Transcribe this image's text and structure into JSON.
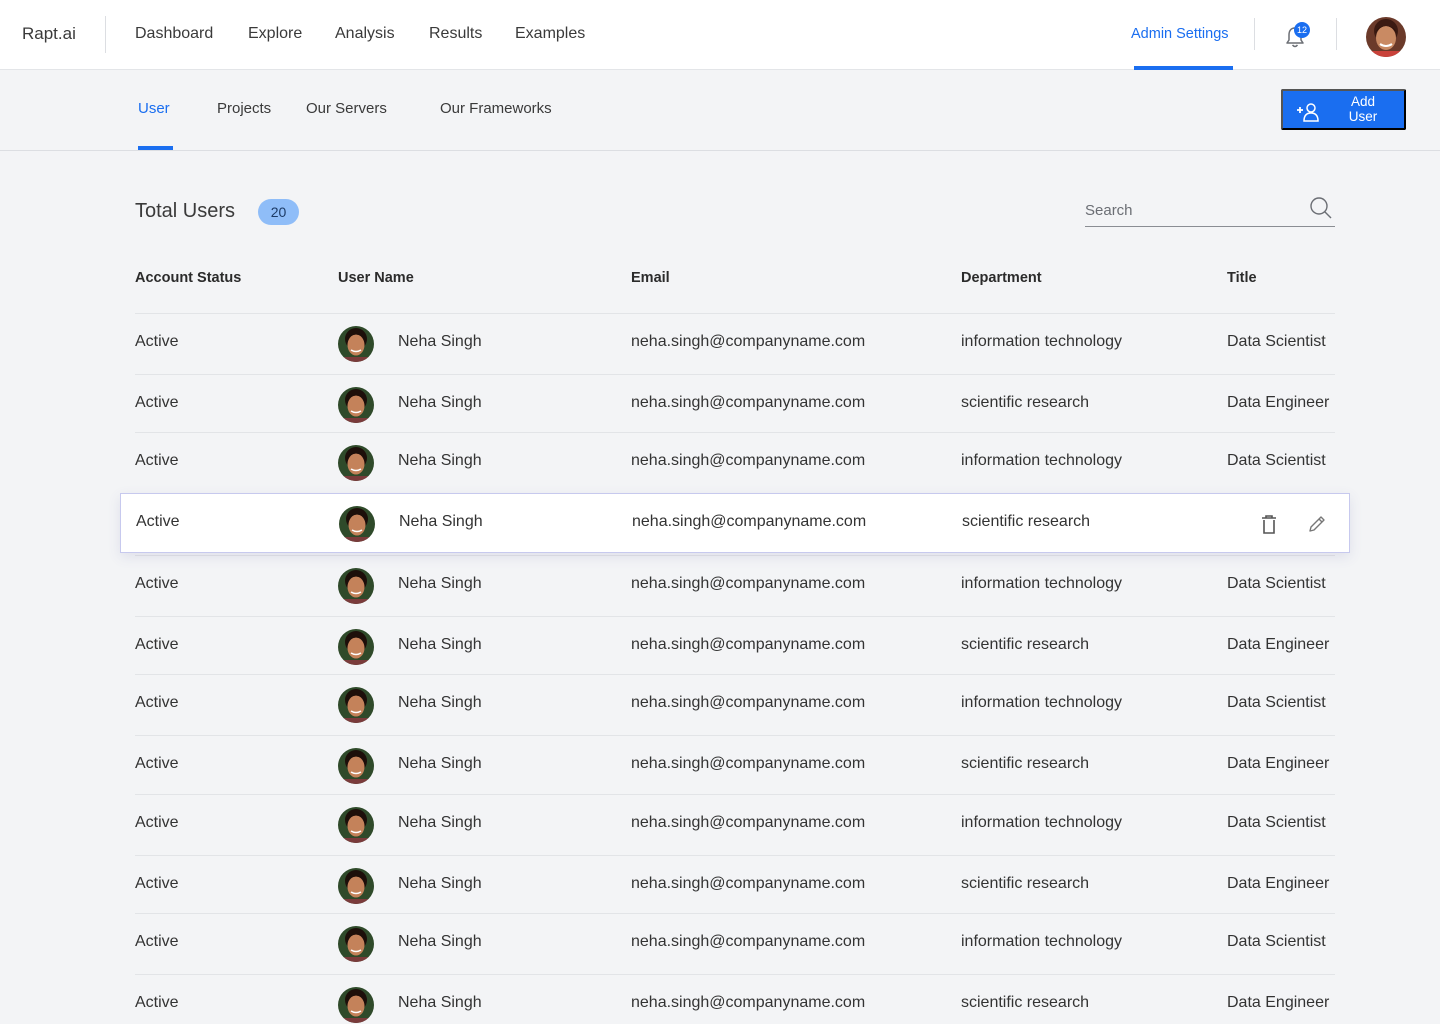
{
  "app": {
    "logo": "Rapt.ai"
  },
  "nav": [
    {
      "label": "Dashboard"
    },
    {
      "label": "Explore"
    },
    {
      "label": "Analysis"
    },
    {
      "label": "Results"
    },
    {
      "label": "Examples"
    }
  ],
  "header": {
    "admin_label": "Admin Settings",
    "notification_count": "12"
  },
  "subnav": {
    "tabs": [
      {
        "label": "User",
        "active": true
      },
      {
        "label": "Projects"
      },
      {
        "label": "Our Servers"
      },
      {
        "label": "Our Frameworks"
      }
    ],
    "add_user_label": "Add User"
  },
  "summary": {
    "title": "Total Users",
    "count": "20"
  },
  "search": {
    "placeholder": "Search"
  },
  "table": {
    "headers": [
      "Account Status",
      "User Name",
      "Email",
      "Department",
      "Title"
    ],
    "rows": [
      {
        "status": "Active",
        "name": "Neha Singh",
        "email": "neha.singh@companyname.com",
        "department": "information technology",
        "title": "Data Scientist"
      },
      {
        "status": "Active",
        "name": "Neha Singh",
        "email": "neha.singh@companyname.com",
        "department": "scientific research",
        "title": "Data Engineer"
      },
      {
        "status": "Active",
        "name": "Neha Singh",
        "email": "neha.singh@companyname.com",
        "department": "information technology",
        "title": "Data Scientist"
      },
      {
        "status": "Active",
        "name": "Neha Singh",
        "email": "neha.singh@companyname.com",
        "department": "scientific research",
        "title": "",
        "hovered": true
      },
      {
        "status": "Active",
        "name": "Neha Singh",
        "email": "neha.singh@companyname.com",
        "department": "information technology",
        "title": "Data Scientist"
      },
      {
        "status": "Active",
        "name": "Neha Singh",
        "email": "neha.singh@companyname.com",
        "department": "scientific research",
        "title": "Data Engineer"
      },
      {
        "status": "Active",
        "name": "Neha Singh",
        "email": "neha.singh@companyname.com",
        "department": "information technology",
        "title": "Data Scientist"
      },
      {
        "status": "Active",
        "name": "Neha Singh",
        "email": "neha.singh@companyname.com",
        "department": "scientific research",
        "title": "Data Engineer"
      },
      {
        "status": "Active",
        "name": "Neha Singh",
        "email": "neha.singh@companyname.com",
        "department": "information technology",
        "title": "Data Scientist"
      },
      {
        "status": "Active",
        "name": "Neha Singh",
        "email": "neha.singh@companyname.com",
        "department": "scientific research",
        "title": "Data Engineer"
      },
      {
        "status": "Active",
        "name": "Neha Singh",
        "email": "neha.singh@companyname.com",
        "department": "information technology",
        "title": "Data Scientist"
      },
      {
        "status": "Active",
        "name": "Neha Singh",
        "email": "neha.singh@companyname.com",
        "department": "scientific research",
        "title": "Data Engineer"
      }
    ],
    "row_actions": [
      "trash-icon",
      "pencil-icon"
    ]
  },
  "colors": {
    "accent": "#1a6ef0",
    "badge": "#8fbdf8",
    "background": "#f3f4f6"
  }
}
